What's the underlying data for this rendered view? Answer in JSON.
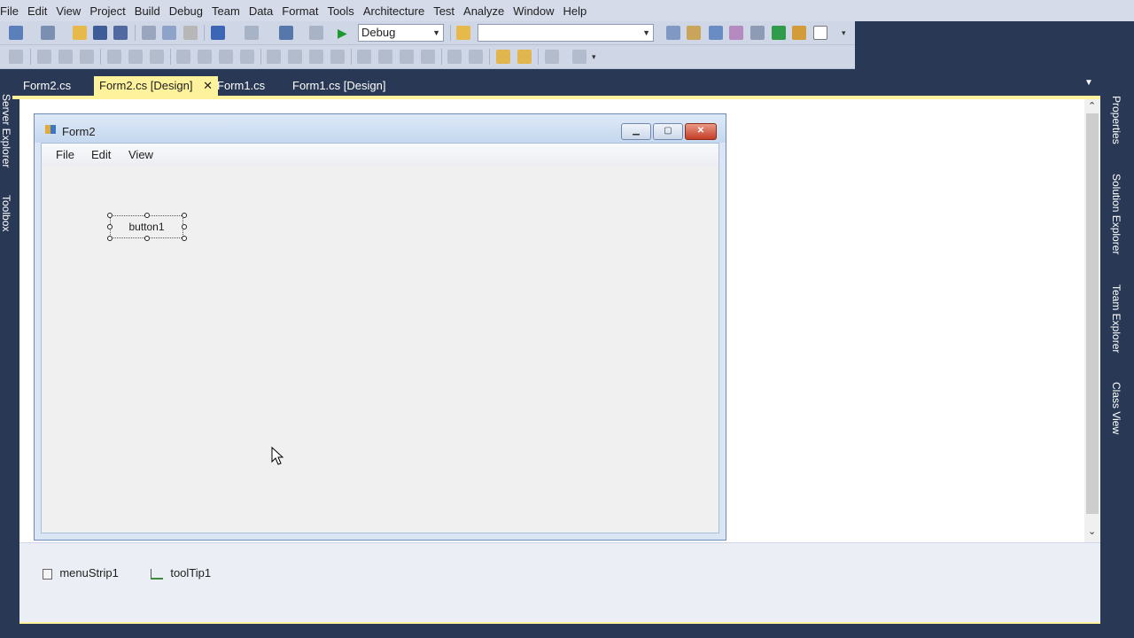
{
  "menubar": {
    "items": [
      "File",
      "Edit",
      "View",
      "Project",
      "Build",
      "Debug",
      "Team",
      "Data",
      "Format",
      "Tools",
      "Architecture",
      "Test",
      "Analyze",
      "Window",
      "Help"
    ]
  },
  "toolbar": {
    "config_combo_value": "Debug",
    "platform_combo_value": ""
  },
  "tabs": [
    {
      "label": "Form2.cs",
      "active": false
    },
    {
      "label": "Form2.cs [Design]",
      "active": true,
      "close_glyph": "✕"
    },
    {
      "label": "Form1.cs",
      "active": false
    },
    {
      "label": "Form1.cs [Design]",
      "active": false
    }
  ],
  "left_panels": [
    "Server Explorer",
    "Toolbox"
  ],
  "right_panels": [
    "Properties",
    "Solution Explorer",
    "Team Explorer",
    "Class View"
  ],
  "form": {
    "title": "Form2",
    "menu": [
      "File",
      "Edit",
      "View"
    ],
    "button_label": "button1"
  },
  "tray": {
    "components": [
      "menuStrip1",
      "toolTip1"
    ]
  },
  "colors": {
    "accent_tab": "#fff29d",
    "ide_background": "#293955",
    "close_button": "#c43c26"
  }
}
